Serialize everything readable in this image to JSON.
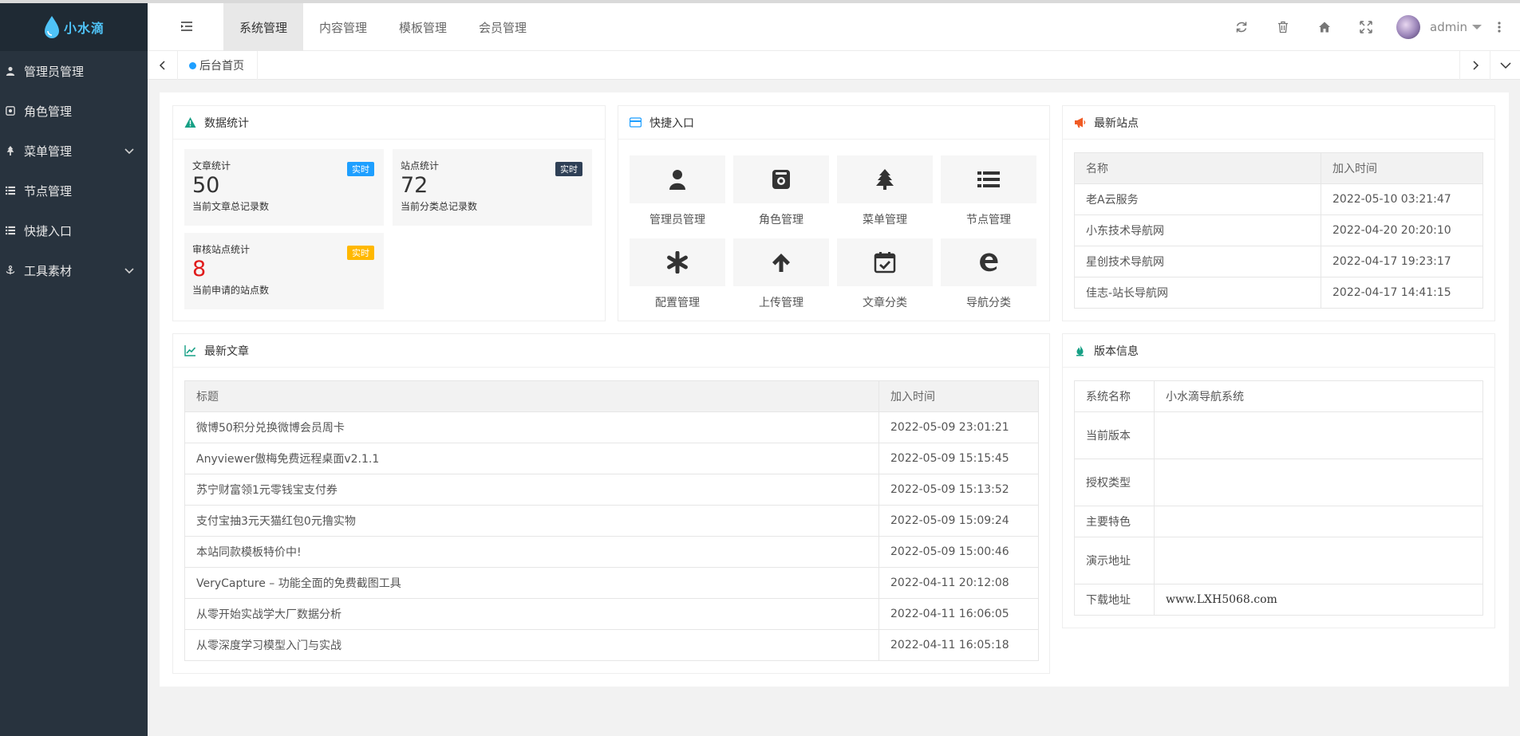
{
  "app": {
    "logo_text": "小水滴",
    "brand_color": "#4fc3f7"
  },
  "sidebar": {
    "items": [
      {
        "label": "管理员管理",
        "icon": "user-icon",
        "has_submenu": false
      },
      {
        "label": "角色管理",
        "icon": "role-icon",
        "has_submenu": false
      },
      {
        "label": "菜单管理",
        "icon": "tree-icon",
        "has_submenu": true
      },
      {
        "label": "节点管理",
        "icon": "list-icon",
        "has_submenu": false
      },
      {
        "label": "快捷入口",
        "icon": "list-icon",
        "has_submenu": false
      },
      {
        "label": "工具素材",
        "icon": "anchor-icon",
        "has_submenu": true
      }
    ]
  },
  "header": {
    "tabs": [
      {
        "label": "系统管理",
        "active": true
      },
      {
        "label": "内容管理",
        "active": false
      },
      {
        "label": "模板管理",
        "active": false
      },
      {
        "label": "会员管理",
        "active": false
      }
    ],
    "username": "admin",
    "icons": [
      "refresh-icon",
      "trash-icon",
      "home-icon",
      "fullscreen-icon"
    ]
  },
  "tabbar": {
    "page_tab": "后台首页"
  },
  "stats_card": {
    "title": "数据统计",
    "items": [
      {
        "title": "文章统计",
        "badge": "实时",
        "badge_color": "#1e9fff",
        "value": "50",
        "value_color": "#333333",
        "desc": "当前文章总记录数"
      },
      {
        "title": "站点统计",
        "badge": "实时",
        "badge_color": "#2f4056",
        "value": "72",
        "value_color": "#333333",
        "desc": "当前分类总记录数"
      },
      {
        "title": "审核站点统计",
        "badge": "实时",
        "badge_color": "#ffb800",
        "value": "8",
        "value_color": "#e01b1b",
        "desc": "当前申请的站点数"
      }
    ]
  },
  "quick_card": {
    "title": "快捷入口",
    "items": [
      {
        "label": "管理员管理",
        "icon": "user-icon"
      },
      {
        "label": "角色管理",
        "icon": "role-icon"
      },
      {
        "label": "菜单管理",
        "icon": "tree-icon"
      },
      {
        "label": "节点管理",
        "icon": "list-icon"
      },
      {
        "label": "配置管理",
        "icon": "asterisk-icon"
      },
      {
        "label": "上传管理",
        "icon": "arrow-up-icon"
      },
      {
        "label": "文章分类",
        "icon": "calendar-check-icon"
      },
      {
        "label": "导航分类",
        "icon": "edge-icon"
      }
    ]
  },
  "sites_card": {
    "title": "最新站点",
    "columns": [
      "名称",
      "加入时间"
    ],
    "rows": [
      [
        "老A云服务",
        "2022-05-10 03:21:47"
      ],
      [
        "小东技术导航网",
        "2022-04-20 20:20:10"
      ],
      [
        "星创技术导航网",
        "2022-04-17 19:23:17"
      ],
      [
        "佳志-站长导航网",
        "2022-04-17 14:41:15"
      ]
    ]
  },
  "articles_card": {
    "title": "最新文章",
    "columns": [
      "标题",
      "加入时间"
    ],
    "rows": [
      [
        "微博50积分兑换微博会员周卡",
        "2022-05-09 23:01:21"
      ],
      [
        "Anyviewer傲梅免费远程桌面v2.1.1",
        "2022-05-09 15:15:45"
      ],
      [
        "苏宁财富领1元零钱宝支付券",
        "2022-05-09 15:13:52"
      ],
      [
        "支付宝抽3元天猫红包0元撸实物",
        "2022-05-09 15:09:24"
      ],
      [
        "本站同款模板特价中!",
        "2022-05-09 15:00:46"
      ],
      [
        "VeryCapture – 功能全面的免费截图工具",
        "2022-04-11 20:12:08"
      ],
      [
        "从零开始实战学大厂数据分析",
        "2022-04-11 16:06:05"
      ],
      [
        "从零深度学习模型入门与实战",
        "2022-04-11 16:05:18"
      ]
    ]
  },
  "version_card": {
    "title": "版本信息",
    "rows": [
      [
        "系统名称",
        "小水滴导航系统"
      ],
      [
        "当前版本",
        ""
      ],
      [
        "授权类型",
        ""
      ],
      [
        "主要特色",
        ""
      ],
      [
        "演示地址",
        ""
      ],
      [
        "下载地址",
        "www.LXH5068.com"
      ]
    ]
  }
}
